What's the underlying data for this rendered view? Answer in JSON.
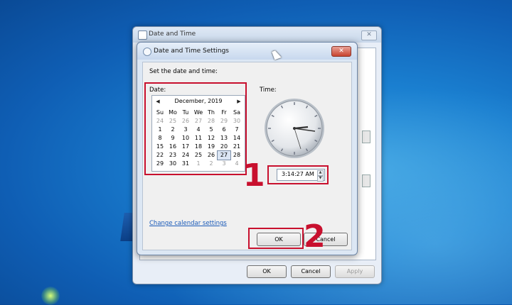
{
  "outer_window": {
    "title": "Date and Time",
    "close_glyph": "✕",
    "buttons": {
      "ok": "OK",
      "cancel": "Cancel",
      "apply": "Apply"
    }
  },
  "dialog": {
    "title": "Date and Time Settings",
    "close_glyph": "✕",
    "instruction": "Set the date and time:",
    "date_label": "Date:",
    "time_label": "Time:",
    "calendar": {
      "month_label": "December, 2019",
      "prev_glyph": "◀",
      "next_glyph": "▶",
      "weekdays": [
        "Su",
        "Mo",
        "Tu",
        "We",
        "Th",
        "Fr",
        "Sa"
      ],
      "weeks": [
        [
          [
            "24",
            1
          ],
          [
            "25",
            1
          ],
          [
            "26",
            1
          ],
          [
            "27",
            1
          ],
          [
            "28",
            1
          ],
          [
            "29",
            1
          ],
          [
            "30",
            1
          ]
        ],
        [
          [
            "1",
            0
          ],
          [
            "2",
            0
          ],
          [
            "3",
            0
          ],
          [
            "4",
            0
          ],
          [
            "5",
            0
          ],
          [
            "6",
            0
          ],
          [
            "7",
            0
          ]
        ],
        [
          [
            "8",
            0
          ],
          [
            "9",
            0
          ],
          [
            "10",
            0
          ],
          [
            "11",
            0
          ],
          [
            "12",
            0
          ],
          [
            "13",
            0
          ],
          [
            "14",
            0
          ]
        ],
        [
          [
            "15",
            0
          ],
          [
            "16",
            0
          ],
          [
            "17",
            0
          ],
          [
            "18",
            0
          ],
          [
            "19",
            0
          ],
          [
            "20",
            0
          ],
          [
            "21",
            0
          ]
        ],
        [
          [
            "22",
            0
          ],
          [
            "23",
            0
          ],
          [
            "24",
            0
          ],
          [
            "25",
            0
          ],
          [
            "26",
            0
          ],
          [
            "27",
            2
          ],
          [
            "28",
            0
          ]
        ],
        [
          [
            "29",
            0
          ],
          [
            "30",
            0
          ],
          [
            "31",
            0
          ],
          [
            "1",
            1
          ],
          [
            "2",
            1
          ],
          [
            "3",
            1
          ],
          [
            "4",
            1
          ]
        ]
      ]
    },
    "time_value": "3:14:27 AM",
    "spin_up": "▲",
    "spin_down": "▼",
    "change_calendar_link": "Change calendar settings",
    "ok_label": "OK",
    "cancel_label": "Cancel"
  },
  "annotations": {
    "step1": "1",
    "step2": "2",
    "color": "#c8102e"
  }
}
